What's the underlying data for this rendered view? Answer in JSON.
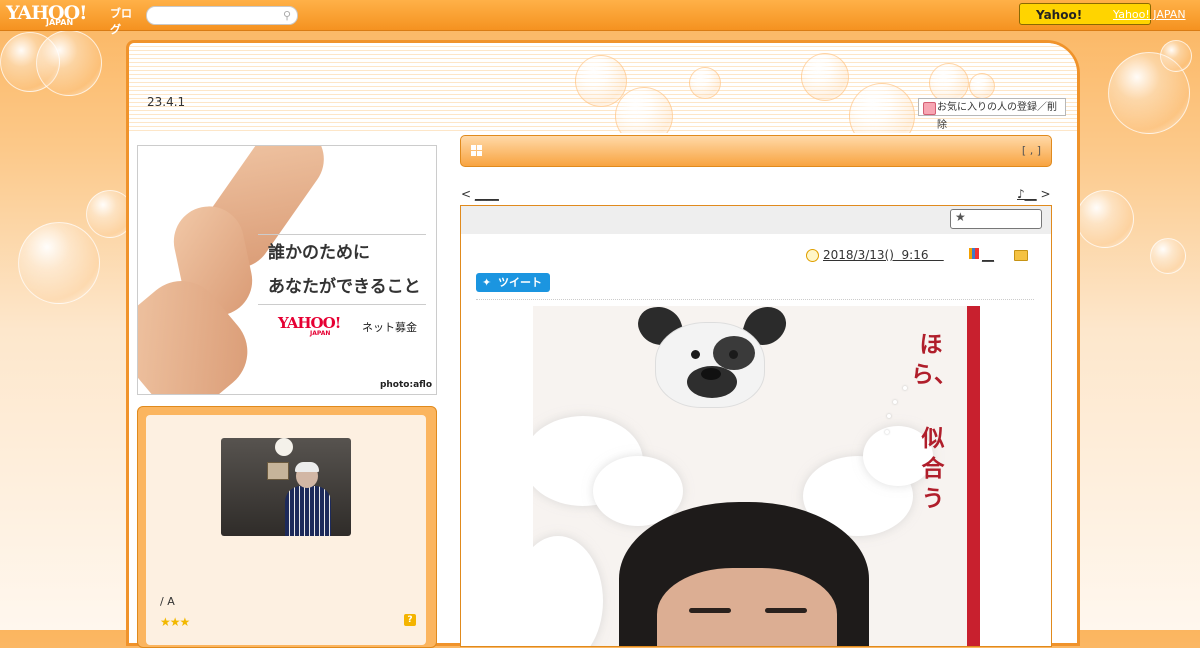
{
  "topbar": {
    "logo_text": "YAHOO!",
    "logo_sub": "JAPAN",
    "blog_label": "ブログ",
    "search_placeholder": "",
    "yahoo_button": "Yahoo!",
    "yahoo_japan_link": "Yahoo! JAPAN"
  },
  "blog": {
    "title": "23.4.1",
    "favorite_button": "お気に入りの人の登録／削除"
  },
  "ad": {
    "line1": "誰かのために",
    "line2": "あなたができること",
    "brand": "YAHOO!",
    "brand_sub": "JAPAN",
    "service": "ネット募金",
    "credit": "photo:aflo"
  },
  "profile": {
    "name": "/ A",
    "stars": "★★★",
    "help_icon": "?"
  },
  "section": {
    "right_text": "[ , ]"
  },
  "nav": {
    "prev_arrow": "<",
    "prev_label": "____",
    "next_label": "♪__",
    "next_arrow": ">"
  },
  "article": {
    "date": "2018/3/13()  9:16    ",
    "book_label": "__",
    "tweet_label": "ツイート",
    "photo_text_1": "ほら、",
    "photo_text_2": "似合う"
  },
  "colors": {
    "accent": "#f0932b",
    "tweet": "#1b95e0",
    "yahoo_button": "#ffd400"
  },
  "icons": [
    "search-icon",
    "heart-icon",
    "grid-icon",
    "star-icon",
    "clock-icon",
    "book-icon",
    "folder-icon",
    "twitter-bird-icon",
    "help-icon"
  ]
}
